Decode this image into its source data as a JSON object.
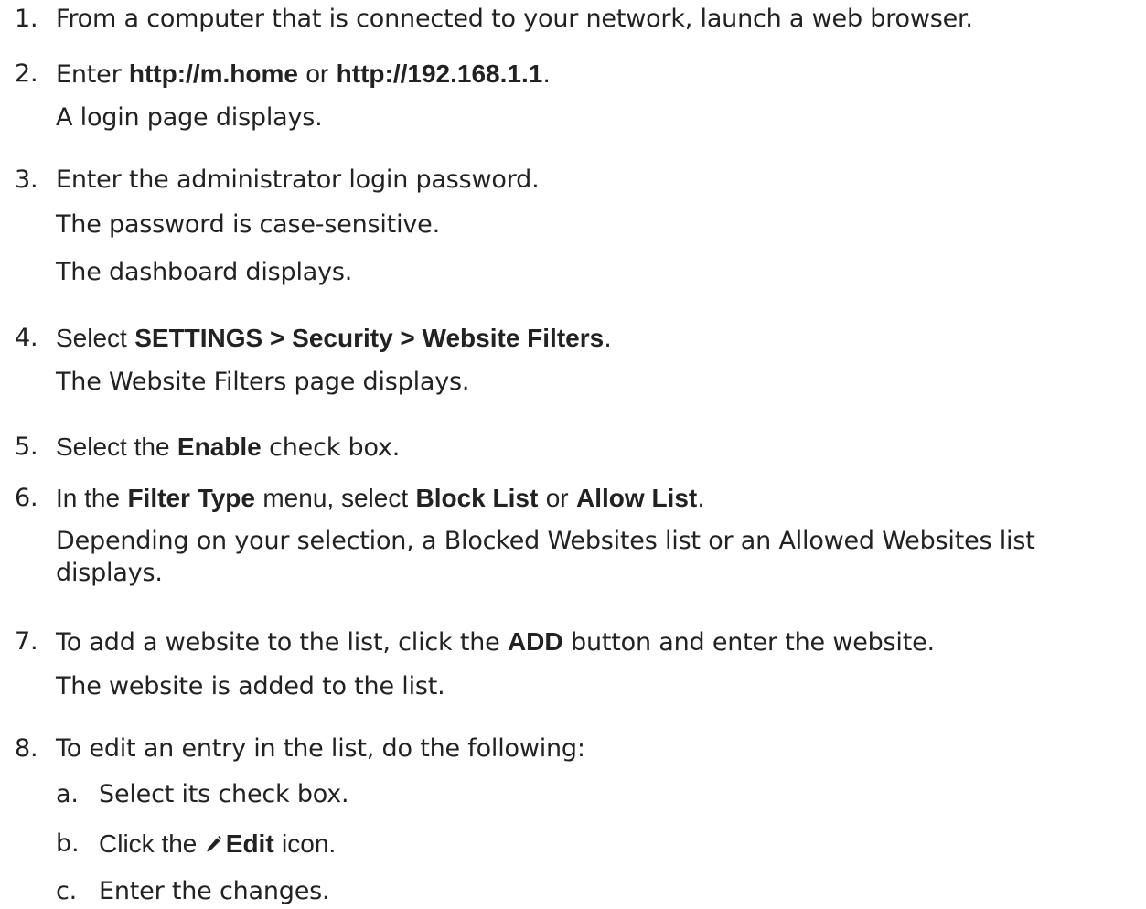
{
  "steps": [
    {
      "num": "1.",
      "text": "From a computer that is connected to your network, launch a web browser."
    },
    {
      "num": "2.",
      "lead": "Enter",
      "url1": "http://m.home",
      "or": "or",
      "url2": "http://192.168.1.1",
      "end": ".",
      "note": "A login page displays."
    },
    {
      "num": "3.",
      "text": "Enter the administrator login password.",
      "note1": "The password is case-sensitive.",
      "note2": "The dashboard displays."
    },
    {
      "num": "4.",
      "lead": "Select",
      "path": "SETTINGS > Security > Website Filters",
      "end": ".",
      "note": "The Website Filters page displays."
    },
    {
      "num": "5.",
      "lead": "Select the",
      "bold": "Enable",
      "tail": "check box."
    },
    {
      "num": "6.",
      "lead": "In the",
      "bold1": "Filter Type",
      "mid1": "menu, select",
      "bold2": "Block List",
      "mid2": "or",
      "bold3": "Allow List",
      "end": ".",
      "note_line1": "Depending on your selection, a Blocked Websites list or an Allowed Websites list",
      "note_line2": "displays."
    },
    {
      "num": "7.",
      "lead": "To add a website to the list, click the",
      "bold": "ADD",
      "tail": "button and enter the website.",
      "note": "The website is added to the list."
    },
    {
      "num": "8.",
      "text": "To edit an entry in the list, do the following:",
      "substeps": [
        {
          "letter": "a.",
          "text": "Select its check box."
        },
        {
          "letter": "b.",
          "lead": "Click the",
          "icon": "pencil-edit-icon",
          "bold": "Edit",
          "tail": "icon."
        },
        {
          "letter": "c.",
          "text": "Enter the changes."
        }
      ]
    }
  ],
  "colors": {
    "text": "#222222",
    "background": "#ffffff",
    "icon": "#222222"
  }
}
